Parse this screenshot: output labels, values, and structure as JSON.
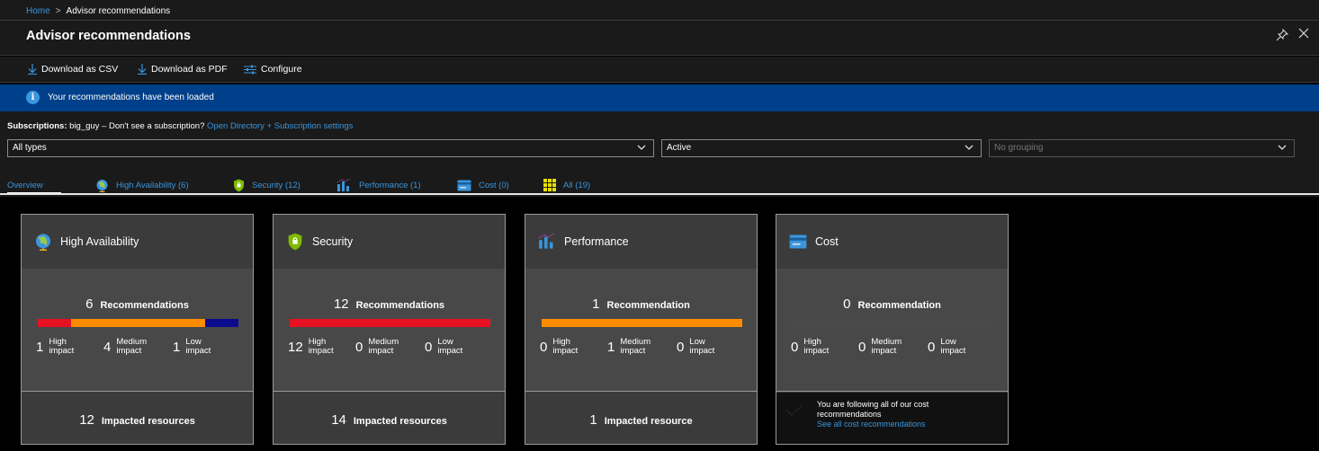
{
  "breadcrumb": {
    "home": "Home",
    "separator": ">",
    "current": "Advisor recommendations"
  },
  "title": "Advisor recommendations",
  "toolbar": {
    "download_csv": "Download as CSV",
    "download_pdf": "Download as PDF",
    "configure": "Configure"
  },
  "info": {
    "icon": "info-icon",
    "message": "Your recommendations have been loaded"
  },
  "subscriptions": {
    "label": "Subscriptions:",
    "value": " big_guy – Don't see a subscription?",
    "link": "Open Directory + Subscription settings"
  },
  "filters": {
    "type": "All types",
    "status": "Active",
    "grouping_placeholder": "No grouping"
  },
  "tabs": [
    {
      "label": "Overview",
      "icon": ""
    },
    {
      "label": "High Availability (6)",
      "icon": "globe-icon"
    },
    {
      "label": "Security (12)",
      "icon": "shield-icon"
    },
    {
      "label": "Performance (1)",
      "icon": "performance-icon"
    },
    {
      "label": "Cost (0)",
      "icon": "cost-icon"
    },
    {
      "label": "All (19)",
      "icon": "grid-icon"
    }
  ],
  "colors": {
    "high": "#e81123",
    "medium": "#ff8c00",
    "low": "#0b0b8e",
    "empty": "#4a4a4a",
    "accent": "#3a96dd",
    "info_bar": "#003f8a"
  },
  "cards": [
    {
      "title": "High Availability",
      "icon": "globe-icon",
      "rec_count": "6",
      "rec_label": "Recommendations",
      "high": "1",
      "medium": "4",
      "low": "1",
      "bar": [
        1,
        4,
        1
      ],
      "impact_high_1": "High",
      "impact_high_2": "impact",
      "impact_med_1": "Medium",
      "impact_med_2": "impact",
      "impact_low_1": "Low",
      "impact_low_2": "impact",
      "resources_count": "12",
      "resources_label": "Impacted resources"
    },
    {
      "title": "Security",
      "icon": "shield-icon",
      "rec_count": "12",
      "rec_label": "Recommendations",
      "high": "12",
      "medium": "0",
      "low": "0",
      "bar": [
        12,
        0,
        0
      ],
      "impact_high_1": "High",
      "impact_high_2": "impact",
      "impact_med_1": "Medium",
      "impact_med_2": "impact",
      "impact_low_1": "Low",
      "impact_low_2": "impact",
      "resources_count": "14",
      "resources_label": "Impacted resources"
    },
    {
      "title": "Performance",
      "icon": "performance-icon",
      "rec_count": "1",
      "rec_label": "Recommendation",
      "high": "0",
      "medium": "1",
      "low": "0",
      "bar": [
        0,
        1,
        0
      ],
      "impact_high_1": "High",
      "impact_high_2": "impact",
      "impact_med_1": "Medium",
      "impact_med_2": "impact",
      "impact_low_1": "Low",
      "impact_low_2": "impact",
      "resources_count": "1",
      "resources_label": "Impacted resource"
    },
    {
      "title": "Cost",
      "icon": "cost-icon",
      "rec_count": "0",
      "rec_label": "Recommendation",
      "high": "0",
      "medium": "0",
      "low": "0",
      "bar": [
        0,
        0,
        0
      ],
      "impact_high_1": "High",
      "impact_high_2": "impact",
      "impact_med_1": "Medium",
      "impact_med_2": "impact",
      "impact_low_1": "Low",
      "impact_low_2": "impact",
      "following_1": "You are following all of our cost",
      "following_2": "recommendations",
      "following_link": "See all cost recommendations"
    }
  ]
}
